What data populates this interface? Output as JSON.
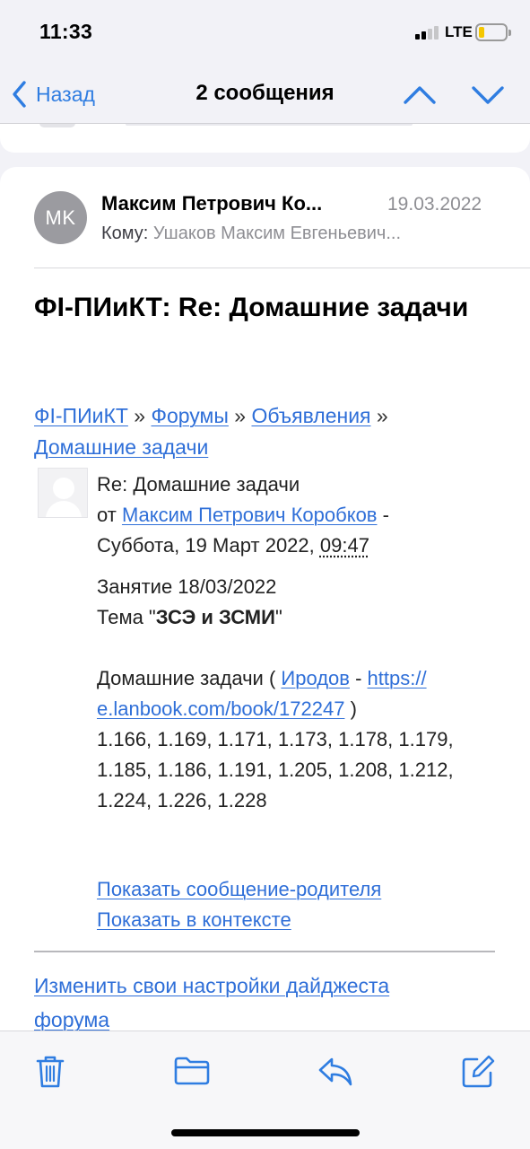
{
  "status_bar": {
    "time": "11:33",
    "network": "LTE",
    "battery_level": 0.2
  },
  "nav": {
    "back_label": "Назад",
    "title": "2 сообщения",
    "up_icon": "chevron-up-icon",
    "down_icon": "chevron-down-icon"
  },
  "message": {
    "avatar_initials": "MK",
    "sender": "Максим Петрович Ко...",
    "date": "19.03.2022",
    "to_label": "Кому:",
    "to_value": "Ушаков Максим Евгеньевич...",
    "subject": "ФI-ПИиКТ: Re: Домашние задачи"
  },
  "breadcrumb": {
    "items": [
      "ФI-ПИиКТ",
      "Форумы",
      "Объявления",
      "Домашние задачи"
    ],
    "separator": "»"
  },
  "post": {
    "title": "Re: Домашние задачи",
    "by_prefix": "от",
    "author": "Максим Петрович Коробков",
    "dash": "-",
    "date": "Суббота, 19 Март 2022,",
    "time": "09:47",
    "lesson": "Занятие 18/03/2022",
    "topic_prefix": "Тема \"",
    "topic": "ЗСЭ и ЗСМИ",
    "topic_suffix": "\"",
    "hw_prefix": "Домашние задачи (",
    "hw_book": "Иродов",
    "hw_sep": "-",
    "hw_url_1": "https://",
    "hw_url_2": "e.lanbook.com/book/172247",
    "hw_close": ")",
    "tasks": [
      "1.166, 1.169, 1.171, 1.173, 1.178, 1.179,",
      "1.185, 1.186, 1.191, 1.205, 1.208, 1.212,",
      "1.224, 1.226, 1.228"
    ],
    "show_parent": "Показать сообщение-родителя",
    "show_context": "Показать в контексте"
  },
  "footer": {
    "digest_line1": "Изменить свои настройки дайджеста",
    "digest_line2": "форума"
  },
  "toolbar": [
    "trash-icon",
    "folder-icon",
    "reply-icon",
    "compose-icon"
  ],
  "colors": {
    "accent": "#2f7de1",
    "link": "#2f6fd8",
    "battery": "#f5c700",
    "secondary_text": "#8e8e93"
  }
}
